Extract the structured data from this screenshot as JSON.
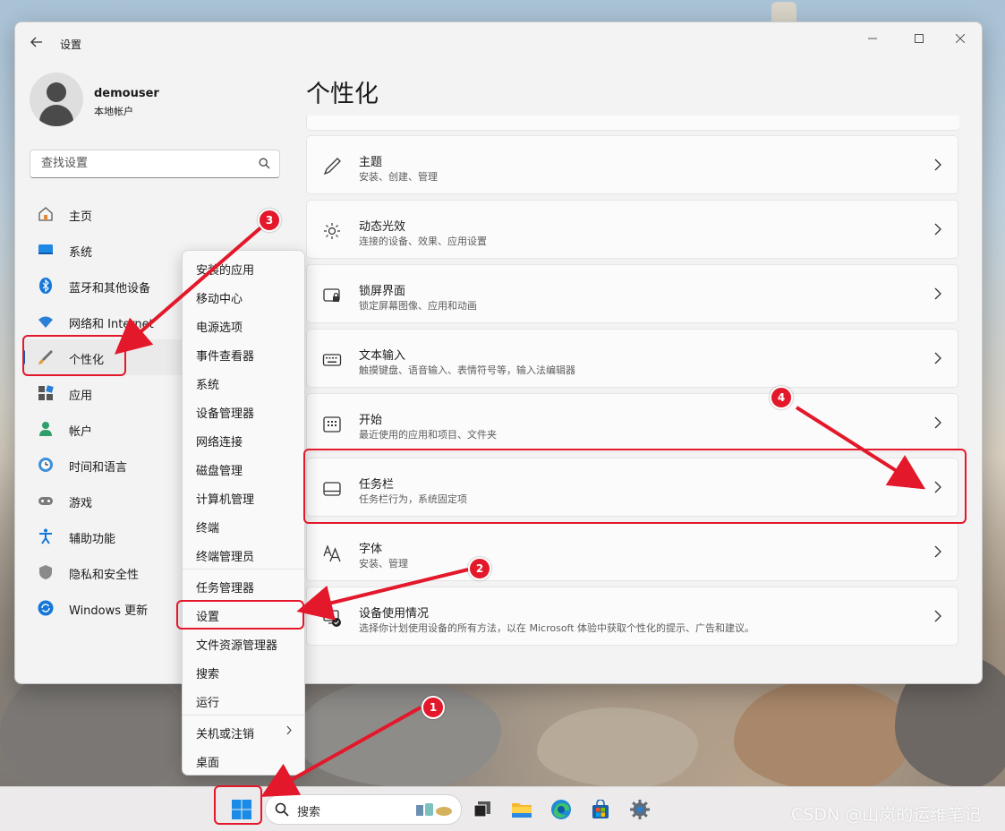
{
  "window": {
    "title": "设置",
    "minimize_icon": "minimize-icon",
    "maximize_icon": "maximize-icon",
    "close_icon": "close-icon"
  },
  "user": {
    "name": "demouser",
    "account_type": "本地帐户"
  },
  "search": {
    "placeholder": "查找设置"
  },
  "sidebar": {
    "items": [
      {
        "label": "主页",
        "icon": "home-icon"
      },
      {
        "label": "系统",
        "icon": "system-icon"
      },
      {
        "label": "蓝牙和其他设备",
        "icon": "bluetooth-icon"
      },
      {
        "label": "网络和 Internet",
        "icon": "wifi-icon"
      },
      {
        "label": "个性化",
        "icon": "brush-icon",
        "active": true
      },
      {
        "label": "应用",
        "icon": "apps-icon"
      },
      {
        "label": "帐户",
        "icon": "account-icon"
      },
      {
        "label": "时间和语言",
        "icon": "time-language-icon"
      },
      {
        "label": "游戏",
        "icon": "gaming-icon"
      },
      {
        "label": "辅助功能",
        "icon": "accessibility-icon"
      },
      {
        "label": "隐私和安全性",
        "icon": "shield-icon"
      },
      {
        "label": "Windows 更新",
        "icon": "update-icon"
      }
    ]
  },
  "main": {
    "title": "个性化",
    "cards": [
      {
        "title": "主题",
        "subtitle": "安装、创建、管理",
        "icon": "pen-icon"
      },
      {
        "title": "动态光效",
        "subtitle": "连接的设备、效果、应用设置",
        "icon": "lighting-icon"
      },
      {
        "title": "锁屏界面",
        "subtitle": "锁定屏幕图像、应用和动画",
        "icon": "lock-screen-icon"
      },
      {
        "title": "文本输入",
        "subtitle": "触摸键盘、语音输入、表情符号等，输入法编辑器",
        "icon": "keyboard-icon"
      },
      {
        "title": "开始",
        "subtitle": "最近使用的应用和项目、文件夹",
        "icon": "start-icon"
      },
      {
        "title": "任务栏",
        "subtitle": "任务栏行为，系统固定项",
        "icon": "taskbar-icon"
      },
      {
        "title": "字体",
        "subtitle": "安装、管理",
        "icon": "font-icon"
      },
      {
        "title": "设备使用情况",
        "subtitle": "选择你计划使用设备的所有方法，以在 Microsoft 体验中获取个性化的提示、广告和建议。",
        "icon": "device-usage-icon"
      }
    ]
  },
  "context_menu": {
    "items": [
      "安装的应用",
      "移动中心",
      "电源选项",
      "事件查看器",
      "系统",
      "设备管理器",
      "网络连接",
      "磁盘管理",
      "计算机管理",
      "终端",
      "终端管理员",
      "任务管理器",
      "设置",
      "文件资源管理器",
      "搜索",
      "运行",
      "关机或注销",
      "桌面"
    ],
    "highlighted": "设置"
  },
  "taskbar": {
    "search_label": "搜索",
    "icons": [
      "start-icon",
      "search-icon",
      "task-view-icon",
      "file-explorer-icon",
      "edge-icon",
      "store-icon",
      "settings-icon"
    ]
  },
  "annotations": {
    "badges": [
      "1",
      "2",
      "3",
      "4"
    ],
    "color": "#e3182a"
  },
  "watermark": "CSDN @山岚的运维笔记",
  "colors": {
    "accent": "#005fb8",
    "annotation_red": "#e3182a",
    "window_bg": "#f3f3f3",
    "card_bg": "#fbfbfb"
  }
}
